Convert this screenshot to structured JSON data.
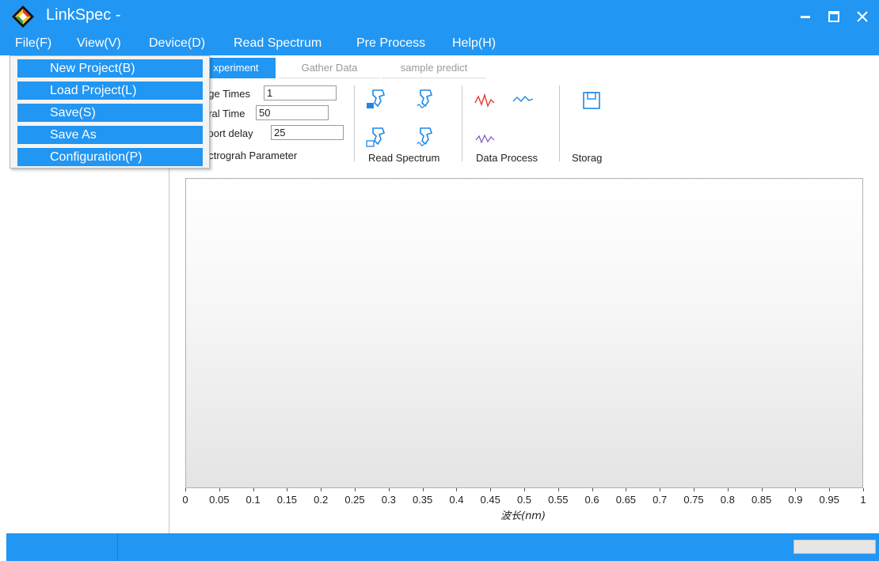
{
  "window": {
    "title": "LinkSpec -",
    "minimize_icon": "minimize-icon",
    "maximize_icon": "maximize-icon",
    "close_icon": "close-icon"
  },
  "menubar": {
    "items": [
      {
        "label": "File(F)"
      },
      {
        "label": "View(V)"
      },
      {
        "label": "Device(D)"
      },
      {
        "label": "Read Spectrum"
      },
      {
        "label": "Pre Process"
      },
      {
        "label": "Help(H)"
      }
    ]
  },
  "file_menu": {
    "items": [
      {
        "label": "New Project(B)"
      },
      {
        "label": "Load Project(L)"
      },
      {
        "label": "Save(S)"
      },
      {
        "label": "Save As"
      },
      {
        "label": "Configuration(P)"
      }
    ]
  },
  "tabs": [
    {
      "label": "xperiment",
      "active": true
    },
    {
      "label": "Gather Data",
      "active": false
    },
    {
      "label": "sample predict",
      "active": false
    }
  ],
  "ribbon": {
    "spectrograph": {
      "average_times_label": "age Times",
      "average_times_value": "1",
      "integral_time_label": "gral Time",
      "integral_time_value": "50",
      "serial_port_delay_label": "l port delay",
      "serial_port_delay_value": "25",
      "group_label": "ectrograh Parameter"
    },
    "read_spectrum": {
      "group_label": "Read Spectrum",
      "buttons": [
        "scanner-dark-icon",
        "scanner-wave-icon",
        "scanner-outline-icon",
        "scanner-wave-icon"
      ]
    },
    "data_process": {
      "group_label": "Data Process",
      "buttons": [
        "wave-red-icon",
        "wave-blue-icon",
        "wave-small-icon"
      ]
    },
    "storage": {
      "group_label": "Storag",
      "buttons": [
        "save-icon"
      ]
    }
  },
  "chart_data": {
    "type": "line",
    "xlabel": "波长(nm)",
    "xlim": [
      0,
      1
    ],
    "x_ticks": [
      "0",
      "0.05",
      "0.1",
      "0.15",
      "0.2",
      "0.25",
      "0.3",
      "0.35",
      "0.4",
      "0.45",
      "0.5",
      "0.55",
      "0.6",
      "0.65",
      "0.7",
      "0.75",
      "0.8",
      "0.85",
      "0.9",
      "0.95",
      "1"
    ],
    "series": []
  },
  "colors": {
    "accent": "#2196f3",
    "menu_highlight": "#2196f3"
  }
}
